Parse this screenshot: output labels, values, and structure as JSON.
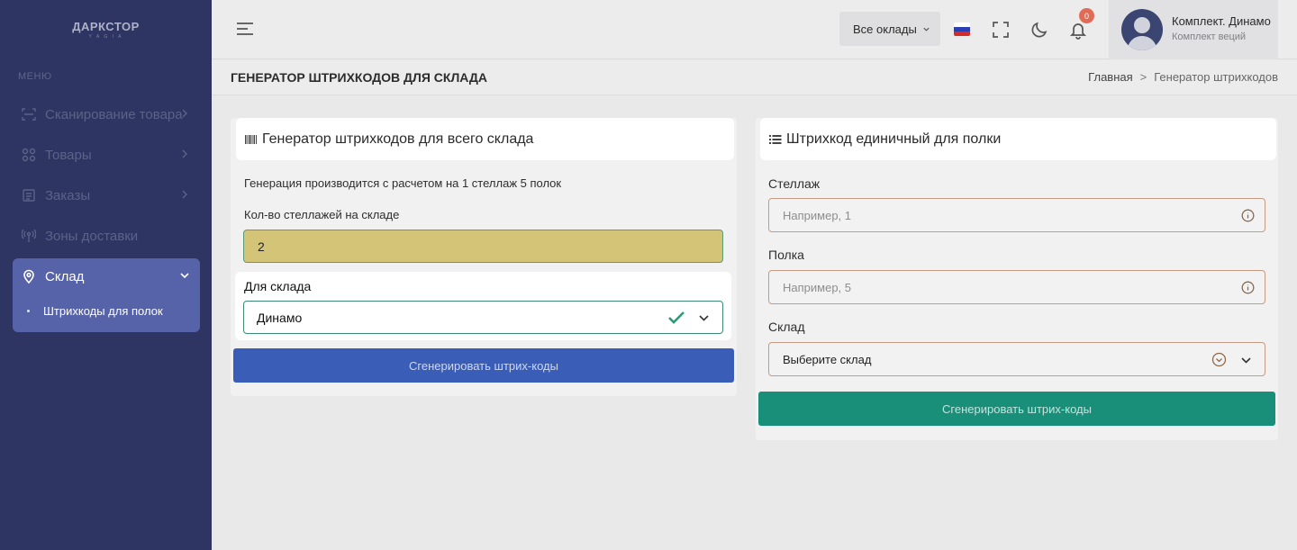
{
  "app": {
    "logo": "ДАРКСТОР",
    "logo_sub": "Y A G I A"
  },
  "sidebar": {
    "menu_title": "МЕНЮ",
    "items": [
      {
        "label": "Сканирование товара",
        "icon": "scan-icon"
      },
      {
        "label": "Товары",
        "icon": "grid-icon"
      },
      {
        "label": "Заказы",
        "icon": "list-icon"
      },
      {
        "label": "Зоны доставки",
        "icon": "antenna-icon"
      },
      {
        "label": "Склад",
        "icon": "map-pin-icon"
      }
    ],
    "subitem": "Штрихкоды для полок"
  },
  "topbar": {
    "warehouse_select": "Все оклады",
    "notifications_count": "0",
    "user_name": "Комплект. Динамо",
    "user_role": "Комплект веций"
  },
  "breadcrumb": {
    "page_title": "ГЕНЕРАТОР ШТРИХКОДОВ ДЛЯ СКЛАДА",
    "home": "Главная",
    "sep": ">",
    "current": "Генератор штрихкодов"
  },
  "left_card": {
    "title": "Генератор штрихкодов для всего склада",
    "info": "Генерация производится с расчетом на 1 стеллаж 5 полок",
    "racks_label": "Кол-во стеллажей на складе",
    "racks_value": "2",
    "warehouse_label": "Для склада",
    "warehouse_value": "Динамо",
    "button": "Сгенерировать штрих-коды"
  },
  "right_card": {
    "title": "Штрихкод единичный для полки",
    "rack_label": "Стеллаж",
    "rack_placeholder": "Например, 1",
    "shelf_label": "Полка",
    "shelf_placeholder": "Например, 5",
    "warehouse_label": "Склад",
    "warehouse_placeholder": "Выберите склад",
    "button": "Сгенерировать штрих-коды"
  },
  "colors": {
    "sidebar_bg": "#2e3563",
    "active_item": "#5763a8",
    "primary_blue": "#3a5eb8",
    "green": "#198f7a",
    "badge": "#e06b56"
  }
}
